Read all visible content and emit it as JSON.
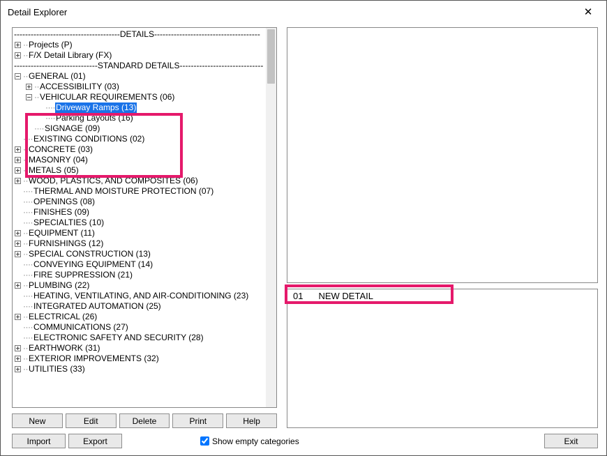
{
  "title": "Detail Explorer",
  "close_glyph": "✕",
  "headers": {
    "details": "DETAILS",
    "standard": "STANDARD DETAILS"
  },
  "tree": {
    "projects": "Projects (P)",
    "fxlib": "F/X Detail Library (FX)",
    "general": "GENERAL (01)",
    "accessibility": "ACCESSIBILITY (03)",
    "vehicular": "VEHICULAR REQUIREMENTS (06)",
    "driveway": "Driveway Ramps (13)",
    "parking": "Parking Layouts (16)",
    "signage": "SIGNAGE (09)",
    "existing": "EXISTING CONDITIONS (02)",
    "concrete": "CONCRETE (03)",
    "masonry": "MASONRY (04)",
    "metals": "METALS (05)",
    "wood": "WOOD, PLASTICS, AND COMPOSITES (06)",
    "thermal": "THERMAL AND MOISTURE PROTECTION (07)",
    "openings": "OPENINGS (08)",
    "finishes": "FINISHES (09)",
    "specialties": "SPECIALTIES (10)",
    "equipment": "EQUIPMENT (11)",
    "furnishings": "FURNISHINGS (12)",
    "special": "SPECIAL CONSTRUCTION (13)",
    "conveying": "CONVEYING EQUIPMENT (14)",
    "fire": "FIRE SUPPRESSION (21)",
    "plumbing": "PLUMBING (22)",
    "hvac": "HEATING, VENTILATING, AND AIR-CONDITIONING (23)",
    "integrated": "INTEGRATED AUTOMATION (25)",
    "electrical": "ELECTRICAL (26)",
    "comm": "COMMUNICATIONS (27)",
    "esas": "ELECTRONIC SAFETY AND SECURITY (28)",
    "earthwork": "EARTHWORK (31)",
    "exterior": "EXTERIOR IMPROVEMENTS (32)",
    "utilities": "UTILITIES (33)"
  },
  "detail_list": {
    "row1_num": "01",
    "row1_name": "NEW DETAIL"
  },
  "buttons": {
    "new": "New",
    "edit": "Edit",
    "delete": "Delete",
    "print": "Print",
    "help": "Help",
    "import": "Import",
    "export": "Export",
    "exit": "Exit"
  },
  "checkbox": {
    "show_empty": "Show empty categories"
  }
}
